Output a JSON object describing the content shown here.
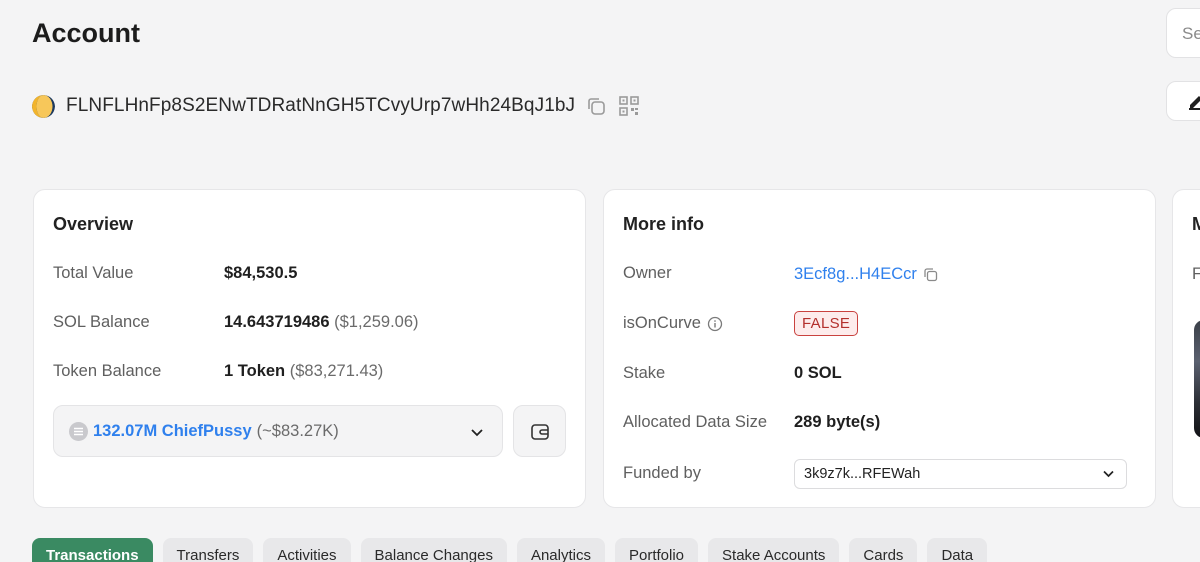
{
  "page": {
    "title": "Account"
  },
  "search": {
    "placeholder": "Se"
  },
  "account": {
    "address": "FLNFLHnFp8S2ENwTDRatNnGH5TCvyUrp7wHh24BqJ1bJ"
  },
  "overview": {
    "title": "Overview",
    "rows": [
      {
        "label": "Total Value",
        "value": "$84,530.5",
        "sub": ""
      },
      {
        "label": "SOL Balance",
        "value": "14.643719486",
        "sub": "($1,259.06)"
      },
      {
        "label": "Token Balance",
        "value": "1 Token",
        "sub": "($83,271.43)"
      }
    ],
    "token_select": {
      "name": "132.07M ChiefPussy",
      "usd": "(~$83.27K)"
    }
  },
  "more_info": {
    "title": "More info",
    "owner_label": "Owner",
    "owner_value": "3Ecf8g...H4ECcr",
    "is_on_curve_label": "isOnCurve",
    "is_on_curve_value": "FALSE",
    "stake_label": "Stake",
    "stake_value": "0 SOL",
    "data_size_label": "Allocated Data Size",
    "data_size_value": "289 byte(s)",
    "funded_label": "Funded by",
    "funded_value": "3k9z7k...RFEWah"
  },
  "right_card": {
    "title_partial": "M",
    "sub_partial": "F"
  },
  "tabs": [
    {
      "label": "Transactions",
      "active": true
    },
    {
      "label": "Transfers"
    },
    {
      "label": "Activities"
    },
    {
      "label": "Balance Changes"
    },
    {
      "label": "Analytics"
    },
    {
      "label": "Portfolio"
    },
    {
      "label": "Stake Accounts"
    },
    {
      "label": "Cards"
    },
    {
      "label": "Data"
    }
  ],
  "colors": {
    "accent_green": "#3a8a62",
    "link_blue": "#2f80ed",
    "false_red": "#b3302d",
    "background": "#f4f4f5"
  },
  "icons": [
    "account-avatar-icon",
    "copy-icon",
    "qr-code-icon",
    "token-icon",
    "chevron-down-icon",
    "wallet-icon",
    "info-icon",
    "edit-icon"
  ]
}
